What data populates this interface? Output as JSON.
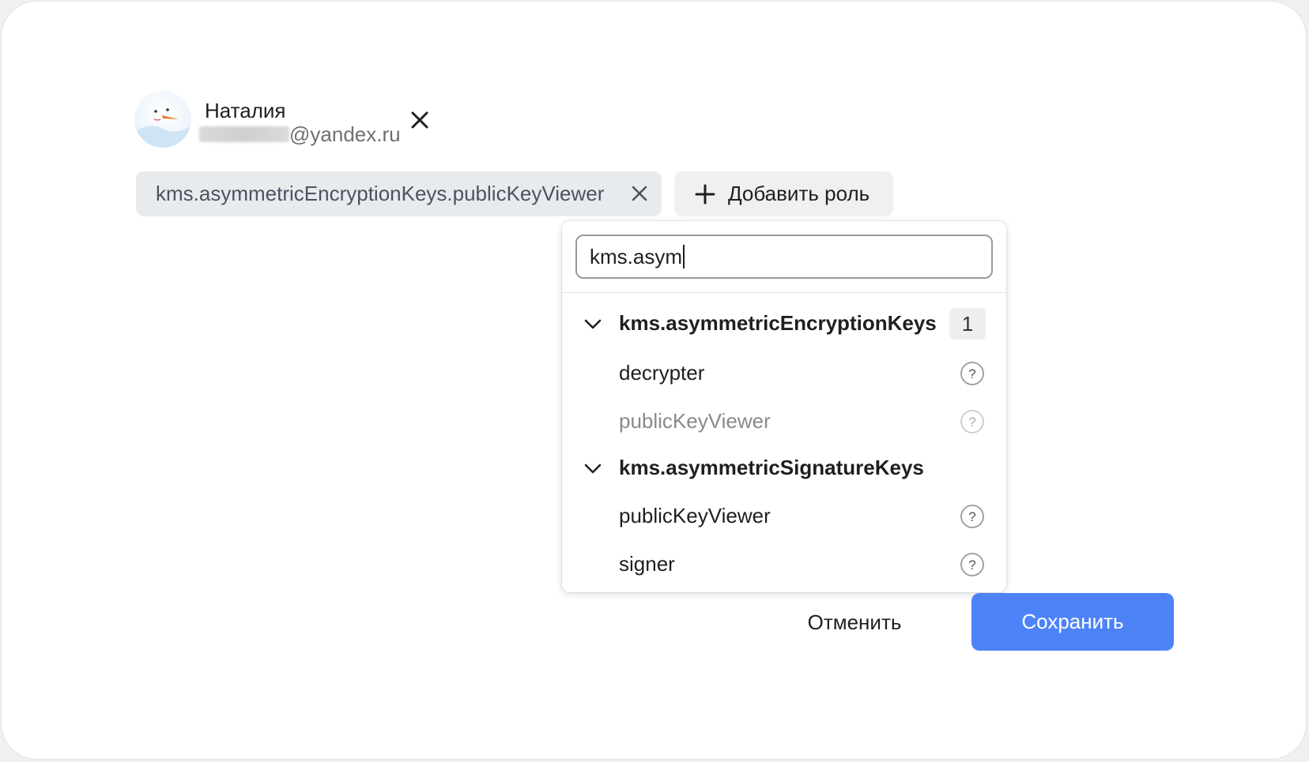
{
  "user": {
    "name": "Наталия",
    "email_domain": "@yandex.ru",
    "avatar_icon": "snowman-avatar-icon",
    "remove_icon": "close-icon"
  },
  "roles": {
    "selected": [
      {
        "label": "kms.asymmetricEncryptionKeys.publicKeyViewer",
        "remove_icon": "close-icon"
      }
    ],
    "add_button": {
      "label": "Добавить роль",
      "icon": "plus-icon"
    }
  },
  "role_picker": {
    "search_value": "kms.asym",
    "groups": [
      {
        "label": "kms.asymmetricEncryptionKeys",
        "expanded": true,
        "selected_count": "1",
        "items": [
          {
            "label": "decrypter",
            "disabled": false,
            "help_icon": "question-icon"
          },
          {
            "label": "publicKeyViewer",
            "disabled": true,
            "help_icon": "question-icon"
          }
        ]
      },
      {
        "label": "kms.asymmetricSignatureKeys",
        "expanded": true,
        "items": [
          {
            "label": "publicKeyViewer",
            "disabled": false,
            "help_icon": "question-icon"
          },
          {
            "label": "signer",
            "disabled": false,
            "help_icon": "question-icon"
          }
        ]
      }
    ]
  },
  "footer": {
    "cancel_label": "Отменить",
    "save_label": "Сохранить"
  },
  "colors": {
    "primary": "#4d83f7",
    "chip_bg": "#e8ebee",
    "muted_text": "#8a8a8a"
  }
}
